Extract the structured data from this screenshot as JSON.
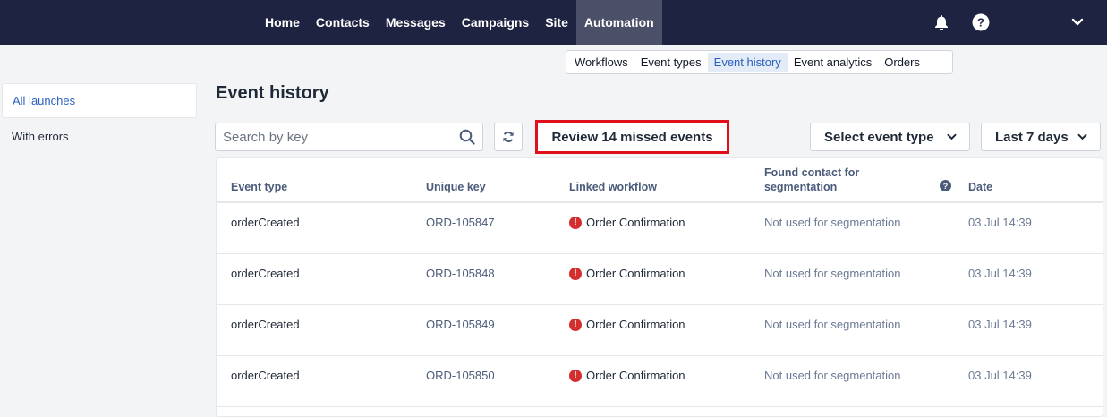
{
  "nav": {
    "items": [
      {
        "label": "Home",
        "active": false
      },
      {
        "label": "Contacts",
        "active": false
      },
      {
        "label": "Messages",
        "active": false
      },
      {
        "label": "Campaigns",
        "active": false
      },
      {
        "label": "Site",
        "active": false
      },
      {
        "label": "Automation",
        "active": true
      }
    ],
    "icons": [
      "bell-icon",
      "help-circle-icon",
      "chevron-down-icon"
    ]
  },
  "subtabs": {
    "items": [
      {
        "label": "Workflows",
        "active": false
      },
      {
        "label": "Event types",
        "active": false
      },
      {
        "label": "Event history",
        "active": true
      },
      {
        "label": "Event analytics",
        "active": false
      },
      {
        "label": "Orders",
        "active": false
      }
    ]
  },
  "sidebar": {
    "items": [
      {
        "label": "All launches",
        "active": true
      },
      {
        "label": "With errors",
        "active": false
      }
    ]
  },
  "main": {
    "title": "Event history",
    "search": {
      "placeholder": "Search by key",
      "value": ""
    },
    "review_button": "Review 14 missed events",
    "event_type_dropdown": "Select event type",
    "period_dropdown": "Last 7 days"
  },
  "table": {
    "headers": {
      "event_type": "Event type",
      "unique_key": "Unique key",
      "linked_workflow": "Linked workflow",
      "found_contact_line1": "Found contact for",
      "found_contact_line2": "segmentation",
      "date": "Date"
    },
    "rows": [
      {
        "event_type": "orderCreated",
        "unique_key": "ORD-105847",
        "workflow": "Order Confirmation",
        "found_contact": "Not used for segmentation",
        "date": "03 Jul 14:39"
      },
      {
        "event_type": "orderCreated",
        "unique_key": "ORD-105848",
        "workflow": "Order Confirmation",
        "found_contact": "Not used for segmentation",
        "date": "03 Jul 14:39"
      },
      {
        "event_type": "orderCreated",
        "unique_key": "ORD-105849",
        "workflow": "Order Confirmation",
        "found_contact": "Not used for segmentation",
        "date": "03 Jul 14:39"
      },
      {
        "event_type": "orderCreated",
        "unique_key": "ORD-105850",
        "workflow": "Order Confirmation",
        "found_contact": "Not used for segmentation",
        "date": "03 Jul 14:39"
      }
    ]
  },
  "colors": {
    "topbar": "#1e2341",
    "accent": "#2b5fbf",
    "highlight_border": "#e0101a",
    "error": "#d32f2f"
  }
}
